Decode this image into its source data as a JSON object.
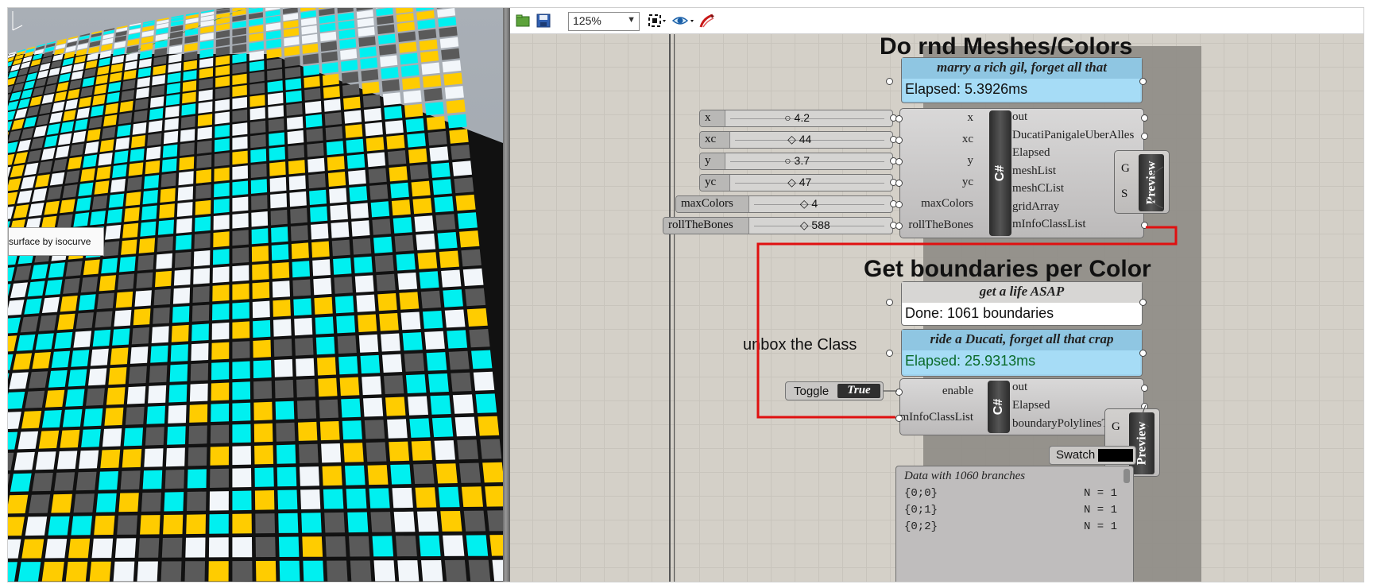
{
  "viewport": {
    "tooltip": "surface by isocurve",
    "tile_colors": [
      "#00f0f0",
      "#ffcc00",
      "#f2f6fa",
      "#5a5a5a"
    ]
  },
  "toolbar": {
    "zoom": "125%",
    "icons": [
      "open-file-icon",
      "save-icon",
      "zoom-extents-icon",
      "eye-icon",
      "sketch-icon"
    ]
  },
  "titles": {
    "meshes": "Do rnd Meshes/Colors",
    "boundaries": "Get boundaries per Color",
    "unbox": "unbox the Class"
  },
  "panel1": {
    "header": "marry a rich gil, forget all that",
    "body": "Elapsed: 5.3926ms"
  },
  "panel2": {
    "header": "get a life ASAP",
    "body": "Done: 1061 boundaries"
  },
  "panel3": {
    "header": "ride a Ducati, forget all that crap",
    "body": "Elapsed: 25.9313ms"
  },
  "sliders": [
    {
      "name": "x",
      "value": "4.2",
      "marker": "○"
    },
    {
      "name": "xc",
      "value": "44",
      "marker": "◇"
    },
    {
      "name": "y",
      "value": "3.7",
      "marker": "○"
    },
    {
      "name": "yc",
      "value": "47",
      "marker": "◇"
    },
    {
      "name": "maxColors",
      "value": "4",
      "marker": "◇"
    },
    {
      "name": "rollTheBones",
      "value": "588",
      "marker": "◇"
    }
  ],
  "comp1": {
    "core": "C#",
    "inputs": [
      "x",
      "xc",
      "y",
      "yc",
      "maxColors",
      "rollTheBones"
    ],
    "outputs": [
      "out",
      "DucatiPanigaleUberAlles",
      "Elapsed",
      "meshList",
      "meshCList",
      "gridArray",
      "mInfoClassList"
    ]
  },
  "comp2": {
    "core": "C#",
    "inputs": [
      "enable",
      "mInfoClassList"
    ],
    "outputs": [
      "out",
      "Elapsed",
      "boundaryPolylinesTree"
    ]
  },
  "toggle": {
    "label": "Toggle",
    "value": "True"
  },
  "swatch": {
    "label": "Swatch",
    "color": "#000000"
  },
  "preview": {
    "label": "Preview",
    "g": "G",
    "s": "S"
  },
  "datapanel": {
    "header": "Data with 1060 branches",
    "rows": [
      {
        "path": "{0;0}",
        "n": "N = 1"
      },
      {
        "path": "{0;1}",
        "n": "N = 1"
      },
      {
        "path": "{0;2}",
        "n": "N = 1"
      }
    ]
  },
  "wire_color": "#e01010"
}
